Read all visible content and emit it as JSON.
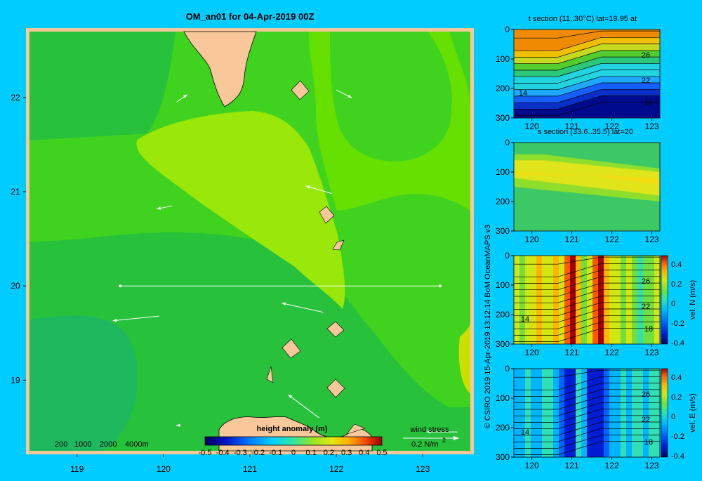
{
  "colors": {
    "background": "#00ccff",
    "land": "#f8c89a",
    "ocean_levels": [
      "#1fb85f",
      "#27c13c",
      "#3fd21e",
      "#66e000",
      "#9ae80a",
      "#cbe000"
    ],
    "section_temp": [
      "#000a8c",
      "#0a2ec8",
      "#1460ff",
      "#1ea8ff",
      "#22d4e0",
      "#2cc87a",
      "#52cc2e",
      "#c6d820",
      "#f0c000",
      "#f08a00"
    ],
    "section_salt": [
      "#3cc864",
      "#8ede2c",
      "#e0e41a",
      "#f2dc14"
    ],
    "vel_scale": [
      "#00005a",
      "#001cd2",
      "#0064ff",
      "#00b4ff",
      "#30e0b4",
      "#70e040",
      "#d2e614",
      "#ffb400",
      "#ff5a00",
      "#a00000"
    ]
  },
  "figure": {
    "credit": "© CSIRO 2019  15-Apr-2019 13:12:14 BoM OceanMAPS v3"
  },
  "chart_data": [
    {
      "type": "heatmap",
      "id": "map",
      "title": "OM_an01 for 04-Apr-2019 00Z",
      "xlabel": "",
      "ylabel": "",
      "xlim": [
        118.45,
        123.55
      ],
      "ylim": [
        18.25,
        22.7
      ],
      "x_ticks": [
        119,
        120,
        121,
        122,
        123
      ],
      "y_ticks": [
        19,
        20,
        21,
        22
      ],
      "tick_labels_x": [
        "119",
        "120",
        "121",
        "122",
        "123"
      ],
      "tick_labels_y": [
        "19",
        "20",
        "21",
        "22"
      ],
      "section_line": {
        "lon": [
          119.5,
          123.2
        ],
        "lat": 20.0
      },
      "wind_vectors": [
        {
          "lon": 120.15,
          "lat": 21.95,
          "u": 0.07,
          "v": 0.05
        },
        {
          "lon": 122.0,
          "lat": 22.08,
          "u": 0.1,
          "v": -0.05
        },
        {
          "lon": 120.1,
          "lat": 20.85,
          "u": -0.1,
          "v": -0.02
        },
        {
          "lon": 121.95,
          "lat": 20.98,
          "u": -0.17,
          "v": 0.05
        },
        {
          "lon": 119.95,
          "lat": 19.68,
          "u": -0.3,
          "v": -0.03
        },
        {
          "lon": 121.85,
          "lat": 19.72,
          "u": -0.27,
          "v": 0.06
        },
        {
          "lon": 120.2,
          "lat": 18.52,
          "u": -0.03,
          "v": 0.0
        },
        {
          "lon": 121.8,
          "lat": 18.6,
          "u": -0.2,
          "v": 0.15
        },
        {
          "lon": 123.4,
          "lat": 18.45,
          "u": -0.2,
          "v": 0.0
        }
      ],
      "colorbar": {
        "label": "height anomaly (m)",
        "ticks": [
          "-0.5",
          "-0.4",
          "-0.3",
          "-0.2",
          "-0.1",
          "0",
          "0.1",
          "0.2",
          "0.3",
          "0.4",
          "0.5"
        ],
        "range": [
          -0.5,
          0.5
        ]
      },
      "depth_legend": [
        "200",
        "1000",
        "2000",
        "4000m"
      ],
      "wind_legend": {
        "label": "wind stress",
        "value": "0.2 N/m",
        "superscript": "2"
      }
    },
    {
      "type": "heatmap",
      "id": "t-section",
      "title": "t section (11..30°C) lat=19.95 at",
      "xlim": [
        119.55,
        123.2
      ],
      "ylim": [
        300,
        0
      ],
      "x_ticks": [
        "120",
        "121",
        "122",
        "123"
      ],
      "y_ticks": [
        "0",
        "100",
        "200",
        "300"
      ],
      "contour_labels": [
        "26",
        "22",
        "14",
        "18"
      ]
    },
    {
      "type": "heatmap",
      "id": "s-section",
      "title": "s section (33.6..35.5) lat=20",
      "xlim": [
        119.55,
        123.2
      ],
      "ylim": [
        300,
        0
      ],
      "x_ticks": [
        "120",
        "121",
        "122",
        "123"
      ],
      "y_ticks": [
        "0",
        "100",
        "200",
        "300"
      ]
    },
    {
      "type": "heatmap",
      "id": "vel-n-section",
      "xlim": [
        119.55,
        123.2
      ],
      "ylim": [
        300,
        0
      ],
      "x_ticks": [
        "120",
        "121",
        "122",
        "123"
      ],
      "y_ticks": [
        "0",
        "100",
        "200",
        "300"
      ],
      "contour_labels": [
        "26",
        "22",
        "14",
        "18"
      ],
      "colorbar": {
        "label": "vel. N (m/s)",
        "ticks": [
          "0.4",
          "0.2",
          "0",
          "-0.2",
          "-0.4"
        ],
        "range": [
          -0.4,
          0.4
        ]
      }
    },
    {
      "type": "heatmap",
      "id": "vel-e-section",
      "xlim": [
        119.55,
        123.2
      ],
      "ylim": [
        300,
        0
      ],
      "x_ticks": [
        "120",
        "121",
        "122",
        "123"
      ],
      "y_ticks": [
        "0",
        "100",
        "200",
        "300"
      ],
      "contour_labels": [
        "26",
        "22",
        "14",
        "18"
      ],
      "colorbar": {
        "label": "vel. E (m/s)",
        "ticks": [
          "0.4",
          "0.2",
          "0",
          "-0.2",
          "-0.4"
        ],
        "range": [
          -0.4,
          0.4
        ]
      }
    }
  ]
}
